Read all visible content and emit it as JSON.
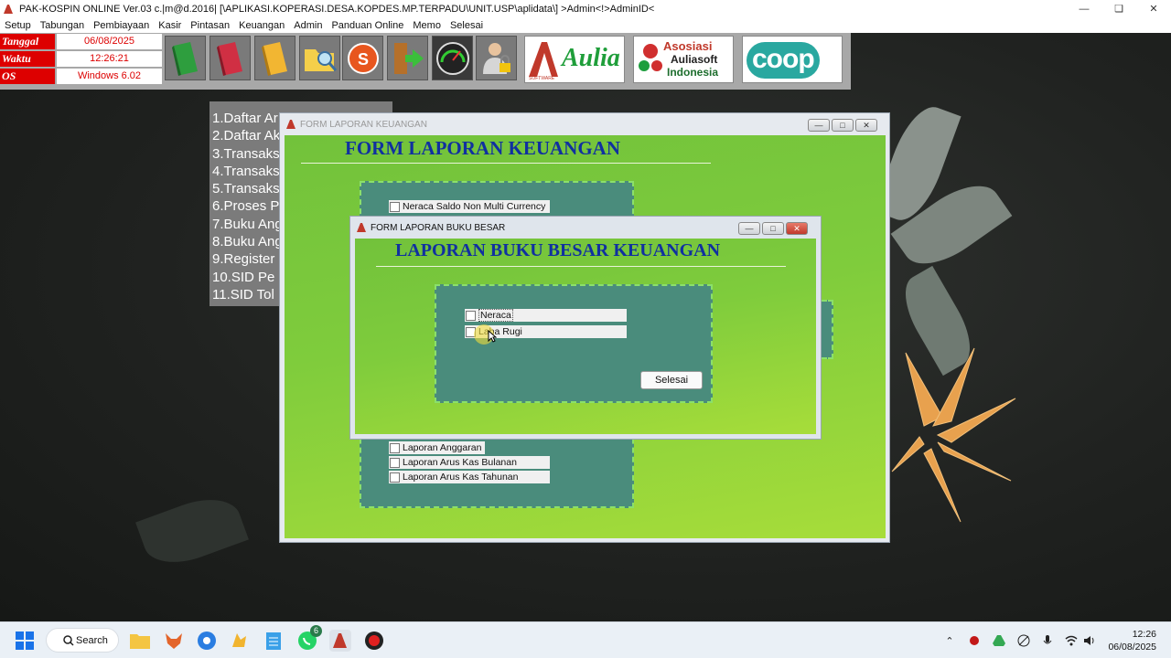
{
  "window": {
    "title": "PAK-KOSPIN ONLINE Ver.03 c.|m@d.2016| [\\APLIKASI.KOPERASI.DESA.KOPDES.MP.TERPADU\\UNIT.USP\\aplidata\\] >Admin<!>AdminID<"
  },
  "menu": [
    "Setup",
    "Tabungan",
    "Pembiayaan",
    "Kasir",
    "Pintasan",
    "Keuangan",
    "Admin",
    "Panduan Online",
    "Memo",
    "Selesai"
  ],
  "info": {
    "tanggal_label": "Tanggal",
    "tanggal_value": "06/08/2025",
    "waktu_label": "Waktu",
    "waktu_value": "12:26:21",
    "os_label": "OS",
    "os_value": "Windows 6.02"
  },
  "logos": {
    "aulia": "Aulia",
    "aulia_sub": "SOFTWARE",
    "asosiasi": "Asosiasi",
    "auliasoft": "Auliasoft",
    "indonesia": "Indonesia",
    "coop": "coop"
  },
  "side_list": [
    "1.Daftar Ar",
    "2.Daftar Ak",
    "3.Transaks",
    "4.Transaks",
    "5.Transaks",
    "6.Proses P",
    "7.Buku Ang",
    "8.Buku Ang",
    "9.Register",
    "10.SID Pe",
    "11.SID Tol"
  ],
  "form_keuangan": {
    "title": "FORM LAPORAN KEUANGAN",
    "heading": "FORM LAPORAN KEUANGAN",
    "options_top": [
      "Neraca Saldo Non Multi Currency"
    ],
    "options_bottom": [
      "Laporan Anggaran",
      "Laporan Arus Kas Bulanan",
      "Laporan Arus Kas Tahunan"
    ]
  },
  "form_buku_besar": {
    "title": "FORM LAPORAN BUKU BESAR",
    "heading": "LAPORAN BUKU BESAR KEUANGAN",
    "options": [
      "Neraca",
      "Laba Rugi"
    ],
    "selesai": "Selesai"
  },
  "taskbar": {
    "search": "Search",
    "whatsapp_badge": "6",
    "time": "12:26",
    "date": "06/08/2025"
  },
  "colors": {
    "accent_red": "#d00000",
    "form_green": "#7fcc3c",
    "panel_teal": "#4a8c7c",
    "heading_blue": "#1030a0"
  }
}
